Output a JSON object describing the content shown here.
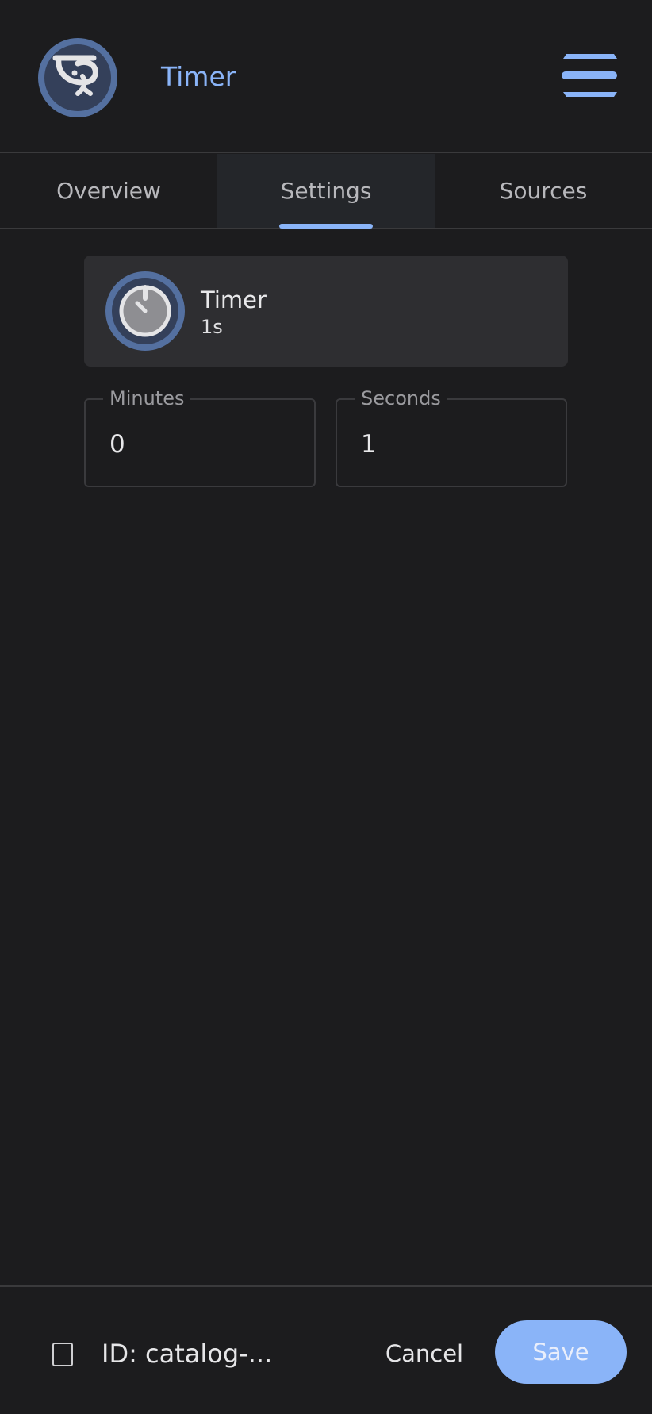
{
  "header": {
    "title": "Timer",
    "logo_icon": "shrimp-icon",
    "menu_icon": "hamburger-menu-icon"
  },
  "tabs": [
    {
      "label": "Overview",
      "active": false
    },
    {
      "label": "Settings",
      "active": true
    },
    {
      "label": "Sources",
      "active": false
    }
  ],
  "summary": {
    "icon": "timer-icon",
    "title": "Timer",
    "subtitle": "1s"
  },
  "fields": {
    "minutes": {
      "label": "Minutes",
      "value": "0"
    },
    "seconds": {
      "label": "Seconds",
      "value": "1"
    }
  },
  "footer": {
    "id_icon": "copy-icon",
    "id_text": "ID: catalog-...",
    "cancel_label": "Cancel",
    "save_label": "Save"
  },
  "colors": {
    "background": "#1c1c1e",
    "accent": "#8ab4f8",
    "card": "#2e2e31",
    "icon_ring": "#5470a0"
  }
}
